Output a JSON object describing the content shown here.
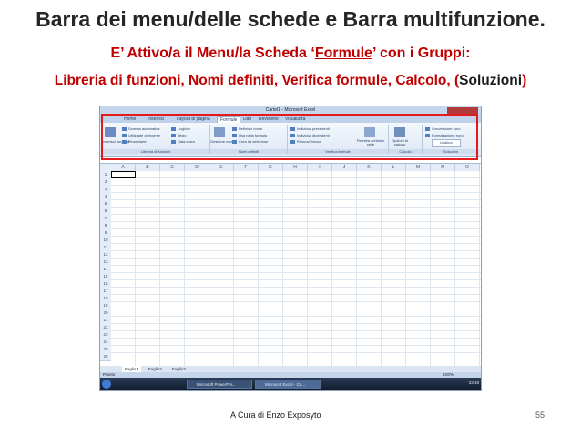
{
  "slide": {
    "title": "Barra dei menu/delle schede e Barra multifunzione.",
    "subtitle_prefix": "E’ Attivo/a il Menu/la Scheda ‘",
    "subtitle_tab": "Formule",
    "subtitle_suffix": "’ con i Gruppi:",
    "groups_line_red": "Libreria di funzioni, Nomi definiti, Verifica formule, Calcolo, ",
    "groups_line_paren_open": "(",
    "groups_line_black": "Soluzioni",
    "groups_line_paren_close": ")",
    "footer": "A Cura di Enzo Exposyto",
    "page_number": "55",
    "highlight_color": "#e3191d"
  },
  "excel": {
    "window_title": "Cartel1 - Microsoft Excel",
    "tabs": [
      "Home",
      "Inserisci",
      "Layout di pagina",
      "Formule",
      "Dati",
      "Revisione",
      "Visualizza"
    ],
    "active_tab": "Formule",
    "ribbon": {
      "group1": {
        "big_button": "Inserisci funzione",
        "items": [
          "Somma automatica",
          "Utilizzate di recente",
          "Finanziarie",
          "Logiche",
          "Testo",
          "Data e ora"
        ],
        "caption": "Libreria di funzioni"
      },
      "group2": {
        "big_button": "Gestione nomi",
        "items": [
          "Definisci nome",
          "Usa nella formula",
          "Crea da selezione"
        ],
        "caption": "Nomi definiti"
      },
      "group3": {
        "items": [
          "Individua precedenti",
          "Individua dipendenti",
          "Rimuovi frecce"
        ],
        "big_button": "Finestra controllo celle",
        "caption": "Verifica formule"
      },
      "group4": {
        "big_button": "Opzioni di calcolo",
        "caption": "Calcolo"
      },
      "group5": {
        "items": [
          "Conversione euro",
          "Formattazione euro",
          "Unalina"
        ],
        "caption": "Soluzioni"
      }
    },
    "columns": [
      "A",
      "B",
      "C",
      "D",
      "E",
      "F",
      "G",
      "H",
      "I",
      "J",
      "K",
      "L",
      "M",
      "N",
      "O"
    ],
    "rows": [
      "1",
      "2",
      "3",
      "4",
      "5",
      "6",
      "7",
      "8",
      "9",
      "10",
      "11",
      "12",
      "13",
      "14",
      "15",
      "16",
      "17",
      "18",
      "19",
      "20",
      "21",
      "22",
      "23",
      "24",
      "25",
      "26"
    ],
    "sheet_tabs": [
      "Foglio1",
      "Foglio2",
      "Foglio3"
    ],
    "status_left": "Pronto",
    "zoom": "100%",
    "taskbar": {
      "items": [
        "Microsoft PowerPoi...",
        "Microsoft Excel - Ca..."
      ],
      "clock": "23:18"
    }
  }
}
